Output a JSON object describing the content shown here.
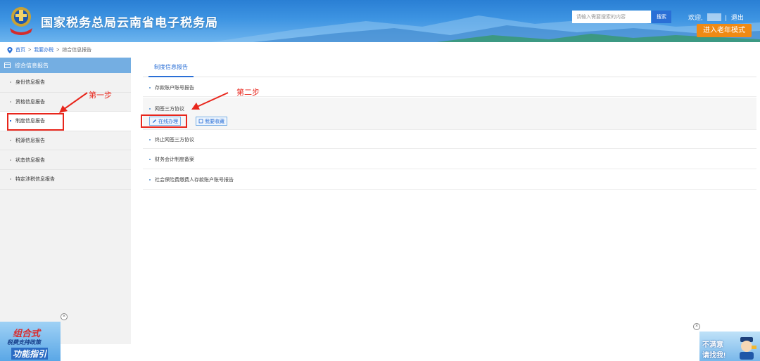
{
  "header": {
    "title": "国家税务总局云南省电子税务局",
    "search_placeholder": "请输入需要搜索的内容",
    "search_button": "搜索",
    "welcome": "欢迎,",
    "separator": "|",
    "logout": "退出",
    "elder_mode": "进入老年模式"
  },
  "breadcrumb": {
    "home": "首页",
    "sep1": ">",
    "level2": "我要办税",
    "sep2": ">",
    "current": "综合信息报告"
  },
  "sidebar": {
    "header": "综合信息报告",
    "items": [
      {
        "label": "身份信息报告"
      },
      {
        "label": "资格信息报告"
      },
      {
        "label": "制度信息报告"
      },
      {
        "label": "税源信息报告"
      },
      {
        "label": "状态信息报告"
      },
      {
        "label": "特定涉税信息报告"
      }
    ]
  },
  "main": {
    "tab": "制度信息报告",
    "items": [
      {
        "label": "存款账户账号报告"
      },
      {
        "label": "网签三方协议"
      },
      {
        "label": "终止网签三方协议"
      },
      {
        "label": "财务会计制度备案"
      },
      {
        "label": "社会保险费缴费人存款账户账号报告"
      }
    ],
    "handle_online": "在线办理",
    "favorite": "我要收藏"
  },
  "annotations": {
    "step1": "第一步",
    "step2": "第二步",
    "color": "#e8261c"
  },
  "banners": {
    "left": {
      "line1": "组合式",
      "line2": "税费支持政策",
      "line3": "功能指引"
    },
    "right": {
      "line1": "不满意",
      "line2": "请找我!"
    },
    "close": "×"
  },
  "colors": {
    "header_blue": "#2a7fd4",
    "accent_blue": "#2a6fd6",
    "sidebar_head": "#74aee2",
    "elder_orange": "#f08a14"
  }
}
